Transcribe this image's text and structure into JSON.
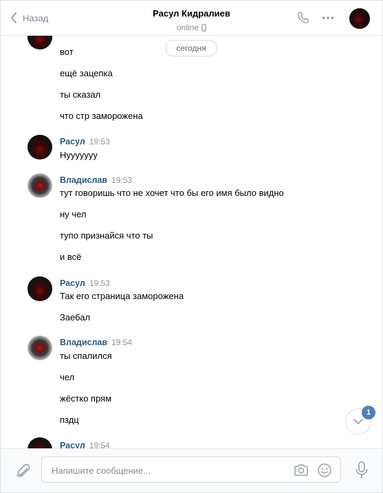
{
  "header": {
    "back_label": "Назад",
    "title": "Расул Кидралиев",
    "status": "online"
  },
  "date_divider": "сегодня",
  "messages": {
    "g1": {
      "lines": [
        "вот",
        "ещё зацепка",
        "ты сказал",
        "что стр заморожена"
      ]
    },
    "g2": {
      "author": "Расул",
      "time": "19:53",
      "lines": [
        "Нууууууу"
      ]
    },
    "g3": {
      "author": "Владислав",
      "time": "19:53",
      "lines": [
        "тут говоришь что не хочет что бы его имя было видно",
        "ну чел",
        "тупо признайся что ты",
        "и всё"
      ]
    },
    "g4": {
      "author": "Расул",
      "time": "19:53",
      "lines": [
        "Так его страница заморожена",
        "Заебал"
      ]
    },
    "g5": {
      "author": "Владислав",
      "time": "19:54",
      "lines": [
        "ты спалился",
        "чел",
        "жёстко прям",
        "пздц"
      ]
    },
    "g6": {
      "author": "Расул",
      "time": "19:54"
    }
  },
  "scroll_badge": "1",
  "composer": {
    "placeholder": "Напишите сообщение..."
  },
  "colors": {
    "link": "#2a5885",
    "muted": "#818c99",
    "accent": "#5181b8"
  }
}
